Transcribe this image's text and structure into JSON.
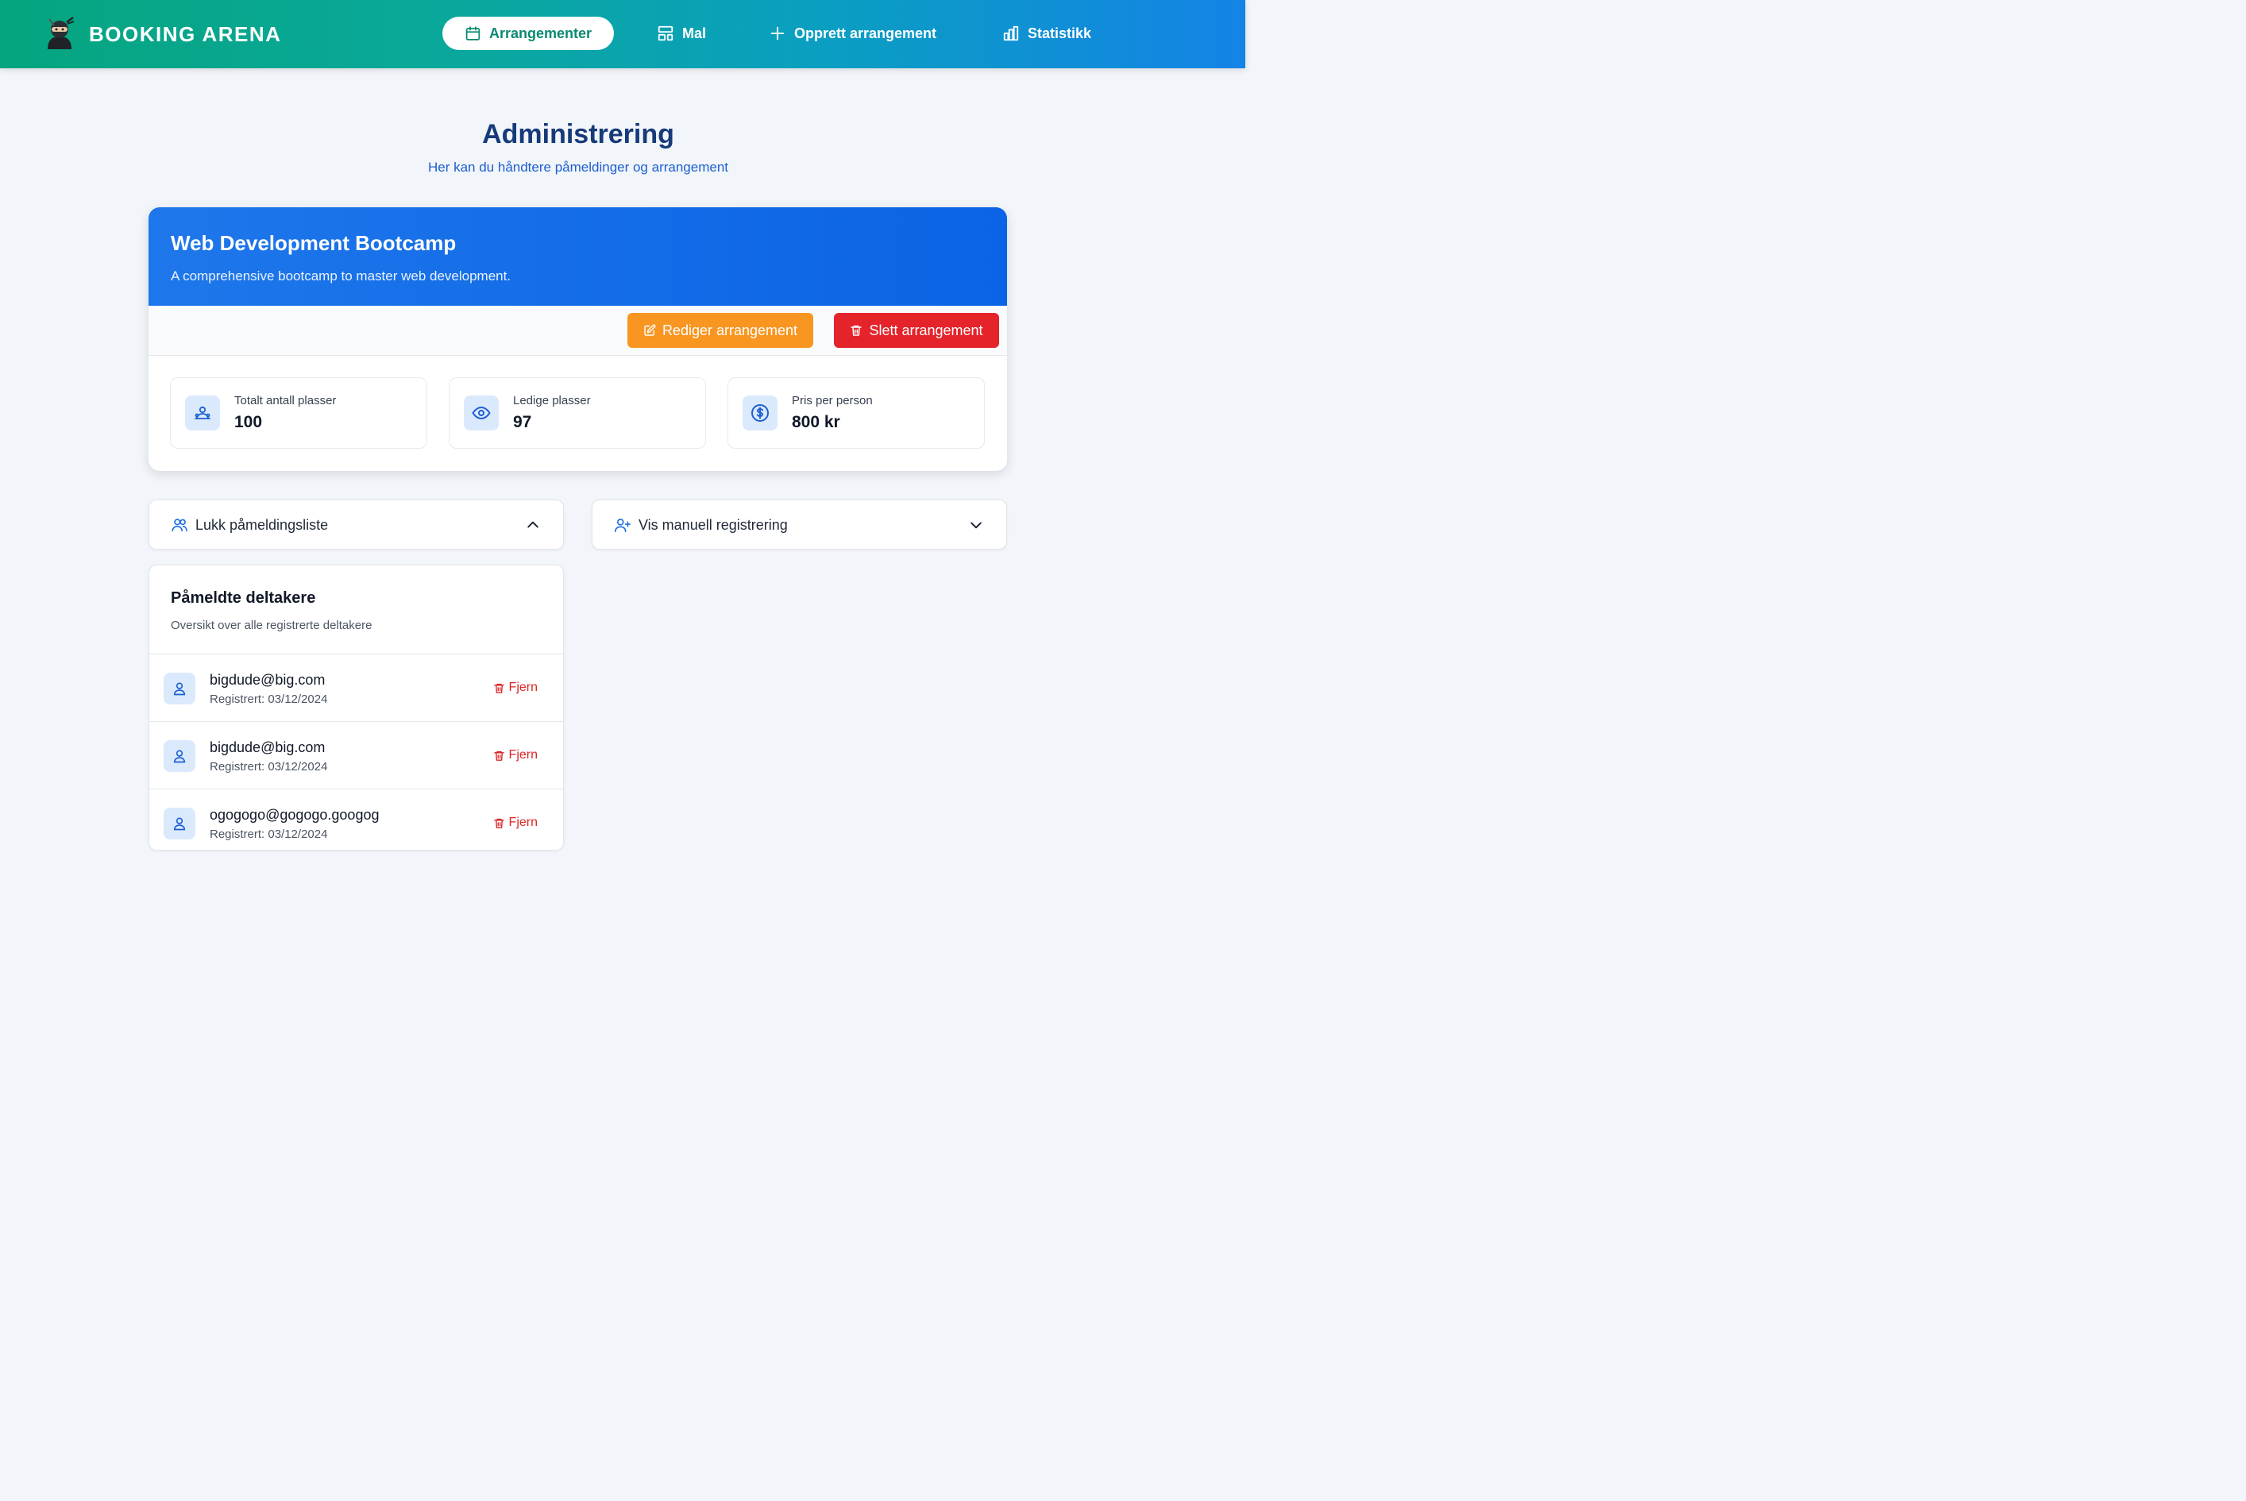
{
  "colors": {
    "accent_green": "#05a57f",
    "accent_blue": "#1483e6",
    "title_navy": "#163a7a",
    "edit_orange": "#f99621",
    "delete_red": "#e5232b",
    "icon_bg": "#dbe9fd"
  },
  "header": {
    "brand": "BOOKING ARENA",
    "brand_icon": "ninja-icon",
    "nav": [
      {
        "label": "Arrangementer",
        "icon": "calendar-icon",
        "active": true
      },
      {
        "label": "Mal",
        "icon": "template-icon",
        "active": false
      },
      {
        "label": "Opprett arrangement",
        "icon": "plus-icon",
        "active": false
      },
      {
        "label": "Statistikk",
        "icon": "bar-chart-icon",
        "active": false
      }
    ]
  },
  "page": {
    "title": "Administrering",
    "subtitle": "Her kan du håndtere påmeldinger og arrangement"
  },
  "event": {
    "title": "Web Development Bootcamp",
    "description": "A comprehensive bootcamp to master web development.",
    "edit_label": "Rediger arrangement",
    "delete_label": "Slett arrangement",
    "stats": [
      {
        "label": "Totalt antall plasser",
        "value": "100",
        "icon": "users-icon"
      },
      {
        "label": "Ledige plasser",
        "value": "97",
        "icon": "eye-icon"
      },
      {
        "label": "Pris per person",
        "value": "800 kr",
        "icon": "dollar-icon"
      }
    ]
  },
  "toggles": {
    "participants_list": {
      "label": "Lukk påmeldingsliste",
      "icon": "users-icon",
      "state": "open"
    },
    "manual_registration": {
      "label": "Vis manuell registrering",
      "icon": "user-plus-icon",
      "state": "closed"
    }
  },
  "participants": {
    "title": "Påmeldte deltakere",
    "subtitle": "Oversikt over alle registrerte deltakere",
    "remove_label": "Fjern",
    "rows": [
      {
        "email": "bigdude@big.com",
        "registered": "Registrert: 03/12/2024"
      },
      {
        "email": "bigdude@big.com",
        "registered": "Registrert: 03/12/2024"
      },
      {
        "email": "ogogogo@gogogo.googog",
        "registered": "Registrert: 03/12/2024"
      }
    ]
  }
}
